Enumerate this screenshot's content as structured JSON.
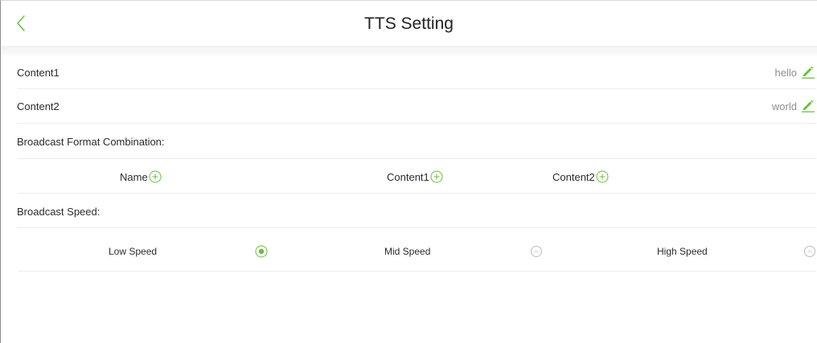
{
  "header": {
    "title": "TTS Setting"
  },
  "content_rows": [
    {
      "label": "Content1",
      "value": "hello"
    },
    {
      "label": "Content2",
      "value": "world"
    }
  ],
  "format": {
    "label": "Broadcast Format Combination:",
    "items": [
      "Name",
      "Content1",
      "Content2"
    ]
  },
  "speed": {
    "label": "Broadcast Speed:",
    "options": [
      {
        "label": "Low Speed",
        "selected": true
      },
      {
        "label": "Mid Speed",
        "selected": false
      },
      {
        "label": "High Speed",
        "selected": false
      }
    ]
  },
  "colors": {
    "accent": "#6abf3c",
    "radio_unselected": "#bdbdbd"
  },
  "icons": {
    "back": "chevron-left-icon",
    "edit": "pencil-icon",
    "add": "plus-circle-icon",
    "radio_on": "radio-selected-icon",
    "radio_off": "radio-unselected-icon"
  }
}
